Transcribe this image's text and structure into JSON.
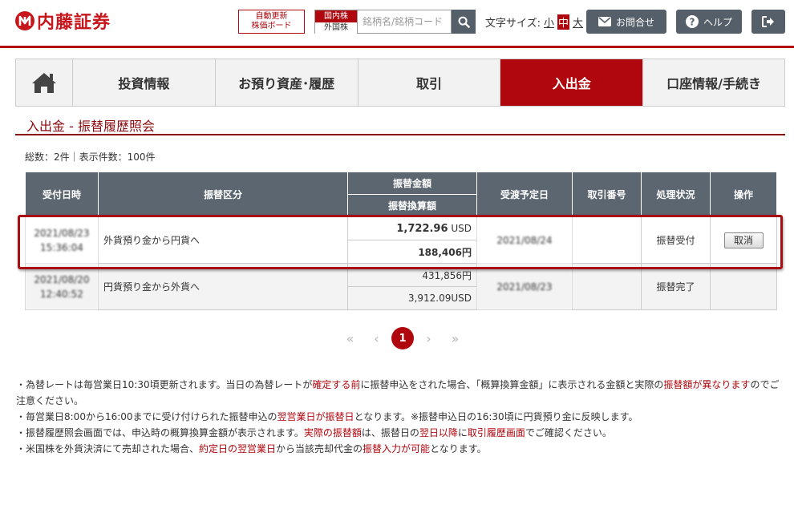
{
  "header": {
    "logo_text": "内藤証券",
    "auto_board_line1": "自動更新",
    "auto_board_line2": "株価ボード",
    "market_domestic": "国内株",
    "market_foreign": "外国株",
    "search_placeholder": "銘柄名/銘柄コード",
    "font_size_label": "文字サイズ:",
    "font_small": "小",
    "font_medium": "中",
    "font_large": "大",
    "contact_label": "お問合せ",
    "help_label": "ヘルプ",
    "accent_color": "#b0060d"
  },
  "nav": {
    "home_icon": "home-icon",
    "items": [
      "投資情報",
      "お預り資産･履歴",
      "取引",
      "入出金",
      "口座情報/手続き"
    ],
    "active": "入出金"
  },
  "page": {
    "title": "入出金 - 振替履歴照会",
    "summary": "総数：2件｜表示件数：100件"
  },
  "table": {
    "headers": {
      "received": "受付日時",
      "category": "振替区分",
      "amount": "振替金額",
      "converted": "振替換算額",
      "settle": "受渡予定日",
      "trade_no": "取引番号",
      "status": "処理状況",
      "action": "操作"
    },
    "rows": [
      {
        "date": "2021/08/23",
        "time": "15:36:04",
        "category": "外貨預り金から円貨へ",
        "amount": "1,722.96",
        "amount_unit": "USD",
        "converted": "188,406円",
        "settle": "2021/08/24",
        "trade_no": "",
        "status": "振替受付",
        "action": "取消"
      },
      {
        "date": "2021/08/20",
        "time": "12:40:52",
        "category": "円貨預り金から外貨へ",
        "amount": "431,856円",
        "converted": "3,912.09USD",
        "settle": "2021/08/23",
        "trade_no": "",
        "status": "振替完了",
        "action": ""
      }
    ]
  },
  "pager": {
    "first": "«",
    "prev": "‹",
    "current": "1",
    "next": "›",
    "last": "»"
  },
  "notes": {
    "n1_a": "・為替レートは毎営業日10:30頃更新されます。当日の為替レートが",
    "n1_b": "確定する前",
    "n1_c": "に振替申込をされた場合、「概算換算金額」に表示される金額と実際の",
    "n1_d": "振替額が異なります",
    "n1_e": "のでご注意ください。",
    "n2_a": "・毎営業日8:00から16:00までに受け付けられた振替申込の",
    "n2_b": "翌営業日が振替日",
    "n2_c": "となります。※振替申込日の16:30頃に円貨預り金に反映します。",
    "n3_a": "・振替履歴照会画面では、申込時の概算換算金額が表示されます。",
    "n3_b": "実際の振替額",
    "n3_c": "は、振替日の",
    "n3_d": "翌日以降",
    "n3_e": "に",
    "n3_f": "取引履歴画面",
    "n3_g": "でご確認ください。",
    "n4_a": "・米国株を外貨決済にて売却された場合、",
    "n4_b": "約定日の翌営業日",
    "n4_c": "から当該売却代金の",
    "n4_d": "振替入力が可能",
    "n4_e": "となります。"
  }
}
